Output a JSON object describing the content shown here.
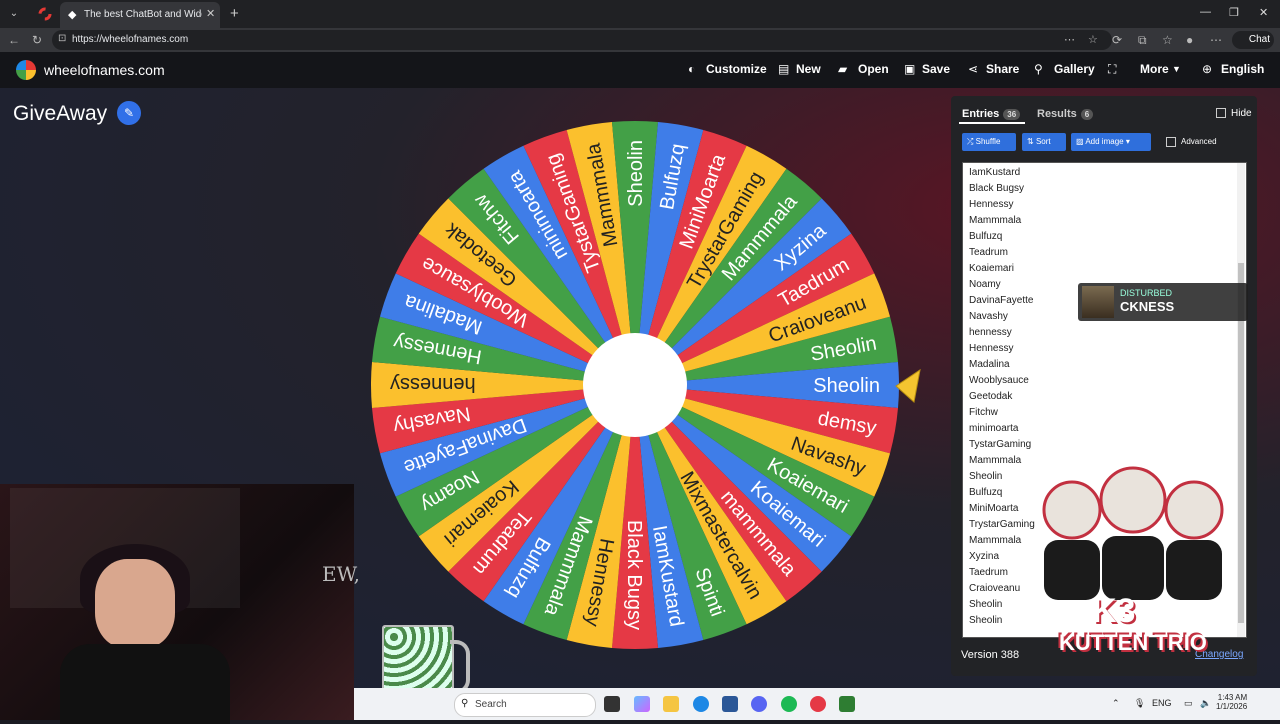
{
  "browser": {
    "tab_title": "The best ChatBot and Widgets for",
    "url": "https://wheelofnames.com",
    "chat_label": "Chat"
  },
  "site": {
    "name": "wheelofnames.com",
    "menu": {
      "customize": "Customize",
      "new": "New",
      "open": "Open",
      "save": "Save",
      "share": "Share",
      "gallery": "Gallery",
      "more": "More",
      "language": "English"
    }
  },
  "wheel": {
    "title": "GiveAway",
    "slices": [
      "Sheolin",
      "Sheolin",
      "demsy",
      "Navashy",
      "Koaiemari",
      "Koaiemari",
      "mammmala",
      "Mixmastercalvin",
      "Spinti",
      "IamKustard",
      "Black Bugsy",
      "Hennessy",
      "Mammmala",
      "Bulfuzq",
      "Teadrum",
      "Koaiemari",
      "Noamy",
      "DavinaFayette",
      "Navashy",
      "hennessy",
      "Hennessy",
      "Madalina",
      "Wooblysauce",
      "Geetodak",
      "Fitchw",
      "minimoarta",
      "TystarGaming",
      "Mammmala",
      "Sheolin",
      "Bulfuzq",
      "MiniMoarta",
      "TrystarGaming",
      "Mammmala",
      "Xyzina",
      "Taedrum",
      "Craioveanu"
    ],
    "colors": [
      "#fbc02d",
      "#43a047",
      "#3f7de8",
      "#e53945"
    ]
  },
  "panel": {
    "entries_label": "Entries",
    "entries_count": "36",
    "results_label": "Results",
    "results_count": "6",
    "hide_label": "Hide",
    "shuffle_label": "Shuffle",
    "sort_label": "Sort",
    "add_image_label": "Add image",
    "advanced_label": "Advanced",
    "entries": [
      "IamKustard",
      "Black Bugsy",
      "Hennessy",
      "Mammmala",
      "Bulfuzq",
      "Teadrum",
      "Koaiemari",
      "Noamy",
      "DavinaFayette",
      "Navashy",
      "hennessy",
      "Hennessy",
      "Madalina",
      "Wooblysauce",
      "Geetodak",
      "Fitchw",
      "minimoarta",
      "TystarGaming",
      "Mammmala",
      "Sheolin",
      "Bulfuzq",
      "MiniMoarta",
      "TrystarGaming",
      "Mammmala",
      "Xyzina",
      "Taedrum",
      "Craioveanu",
      "Sheolin",
      "Sheolin"
    ],
    "version": "Version 388",
    "changelog": "Changelog"
  },
  "overlay": {
    "now_playing_artist": "DISTURBED",
    "now_playing_song": "CKNESS",
    "webcam_wall_text": "EW,",
    "brand_k": "K3",
    "brand_name": "KUTTEN TRIO"
  },
  "taskbar": {
    "search_placeholder": "Search",
    "lang": "ENG",
    "time": "1:43 AM",
    "date": "1/1/2026"
  }
}
